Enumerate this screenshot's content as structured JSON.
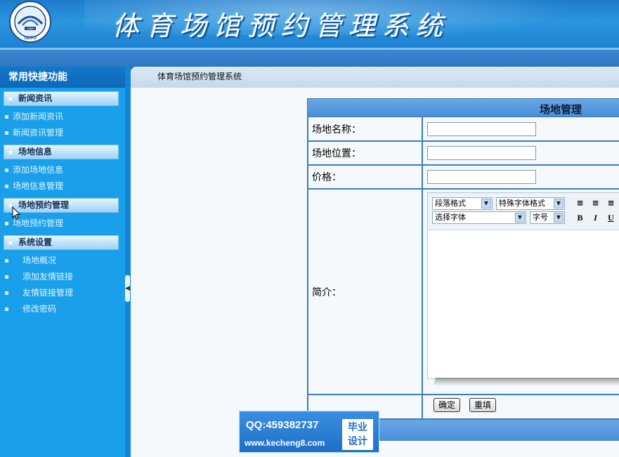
{
  "header": {
    "system_title": "体育场馆预约管理系统",
    "logo_year": "1958",
    "logo_abbr": "GDPU"
  },
  "sidebar": {
    "title": "常用快捷功能",
    "sections": [
      {
        "title": "新闻资讯",
        "items": [
          "添加新闻资讯",
          "新闻资讯管理"
        ]
      },
      {
        "title": "场地信息",
        "items": [
          "添加场地信息",
          "场地信息管理"
        ]
      },
      {
        "title": "场地预约管理",
        "items": [
          "场地预约管理"
        ]
      },
      {
        "title": "系统设置",
        "items": [
          "场地概况",
          "添加友情链接",
          "友情链接管理",
          "修改密码"
        ]
      }
    ]
  },
  "breadcrumb": "体育场馆预约管理系统",
  "form": {
    "title": "场地管理",
    "fields": {
      "name_label": "场地名称：",
      "location_label": "场地位置：",
      "price_label": "价格：",
      "intro_label": "简介："
    },
    "editor": {
      "paragraph_format": "段落格式",
      "special_font_format": "特殊字体格式",
      "font_select": "选择字体",
      "font_size": "字号",
      "bold": "B",
      "italic": "I",
      "underline": "U"
    },
    "confirm_button": "确定",
    "reset_button": "重填"
  },
  "watermark": {
    "qq": "QQ:459382737",
    "site": "www.kecheng8.com",
    "badge_line1": "毕业",
    "badge_line2": "设计"
  },
  "colors": {
    "header_blue": "#1e82d3",
    "sidebar_blue": "#1aa0ea",
    "table_border": "#3b7cc4"
  }
}
